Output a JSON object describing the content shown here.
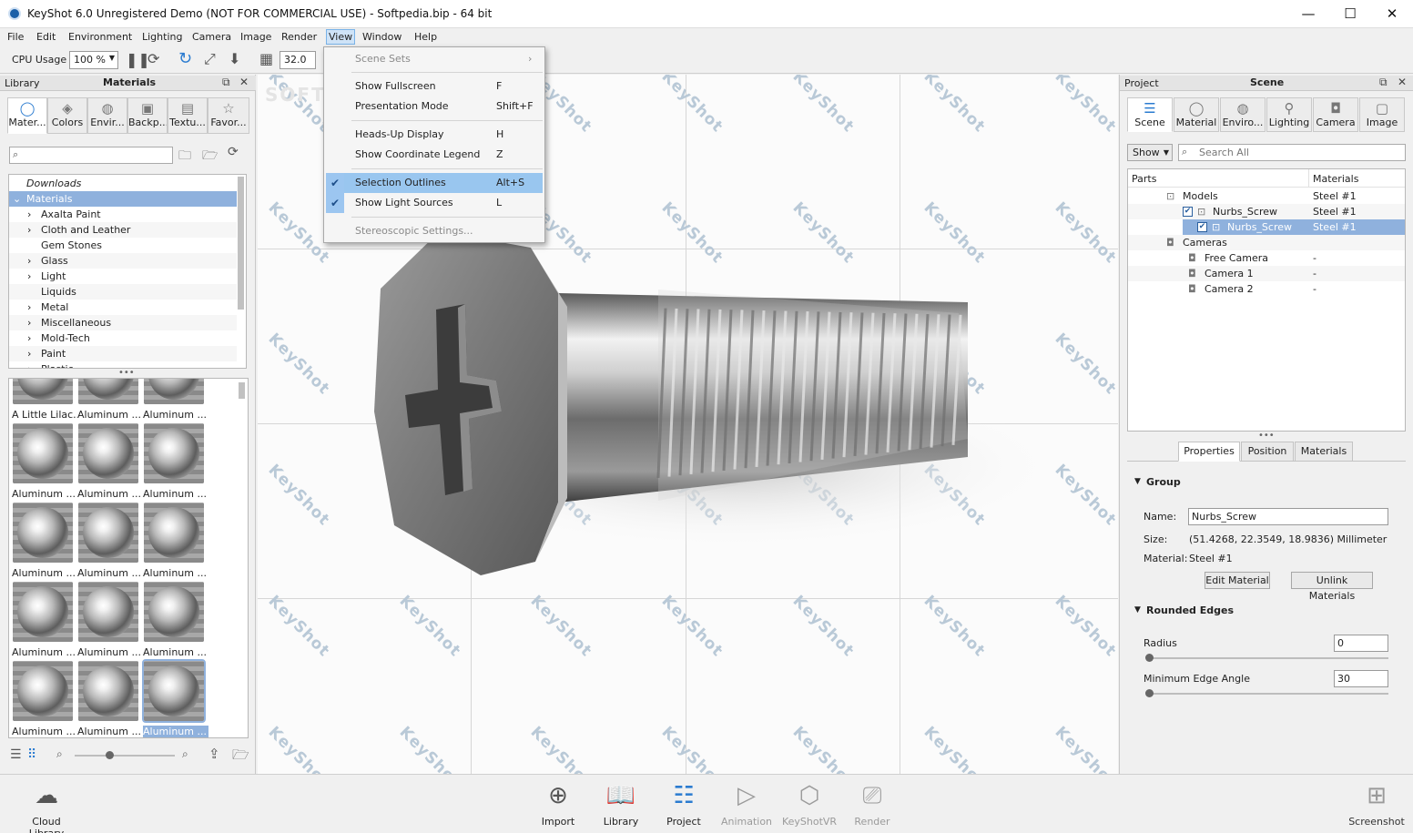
{
  "window": {
    "title": "KeyShot 6.0 Unregistered Demo (NOT FOR COMMERCIAL USE) - Softpedia.bip  - 64 bit",
    "minimize": "—",
    "maximize": "☐",
    "close": "✕"
  },
  "menubar": [
    "File",
    "Edit",
    "Environment",
    "Lighting",
    "Camera",
    "Image",
    "Render",
    "View",
    "Window",
    "Help"
  ],
  "toolbar": {
    "cpu_label": "CPU Usage",
    "cpu_value": "100 %",
    "fov_value": "32.0"
  },
  "view_menu": {
    "items": [
      {
        "label": "Scene Sets",
        "shortcut": "",
        "state": "disabled",
        "submenu": "›"
      },
      {
        "label": "Show Fullscreen",
        "shortcut": "F",
        "state": "normal"
      },
      {
        "label": "Presentation Mode",
        "shortcut": "Shift+F",
        "state": "normal"
      },
      {
        "label": "Heads-Up Display",
        "shortcut": "H",
        "state": "normal"
      },
      {
        "label": "Show Coordinate Legend",
        "shortcut": "Z",
        "state": "normal"
      },
      {
        "label": "Selection Outlines",
        "shortcut": "Alt+S",
        "state": "checked-highlighted"
      },
      {
        "label": "Show Light Sources",
        "shortcut": "L",
        "state": "checked"
      },
      {
        "label": "Stereoscopic Settings...",
        "shortcut": "",
        "state": "disabled"
      }
    ],
    "check_glyph": "✔"
  },
  "library": {
    "header_left": "Library",
    "header_title": "Materials",
    "tabs": [
      {
        "label": "Mater...",
        "icon": "material-icon"
      },
      {
        "label": "Colors",
        "icon": "colors-icon"
      },
      {
        "label": "Envir...",
        "icon": "environment-icon"
      },
      {
        "label": "Backp...",
        "icon": "backplate-icon"
      },
      {
        "label": "Textu...",
        "icon": "texture-icon"
      },
      {
        "label": "Favor...",
        "icon": "favorites-icon"
      }
    ],
    "tree": [
      {
        "label": "Downloads",
        "expander": "",
        "italic": true
      },
      {
        "label": "Materials",
        "expander": "⌄",
        "selected": true
      },
      {
        "label": "Axalta Paint",
        "expander": "›"
      },
      {
        "label": "Cloth and Leather",
        "expander": "›"
      },
      {
        "label": "Gem Stones",
        "expander": ""
      },
      {
        "label": "Glass",
        "expander": "›"
      },
      {
        "label": "Light",
        "expander": "›"
      },
      {
        "label": "Liquids",
        "expander": ""
      },
      {
        "label": "Metal",
        "expander": "›"
      },
      {
        "label": "Miscellaneous",
        "expander": "›"
      },
      {
        "label": "Mold-Tech",
        "expander": "›"
      },
      {
        "label": "Paint",
        "expander": "›"
      },
      {
        "label": "Plastic",
        "expander": "›"
      }
    ],
    "thumbs": [
      "A Little Lilac...",
      "Aluminum ...",
      "Aluminum ...",
      "Aluminum ...",
      "Aluminum ...",
      "Aluminum ...",
      "Aluminum ...",
      "Aluminum ...",
      "Aluminum ...",
      "Aluminum ...",
      "Aluminum ...",
      "Aluminum ...",
      "Aluminum ...",
      "Aluminum ...",
      "Aluminum ..."
    ]
  },
  "viewport": {
    "watermark": "KeyShot",
    "softpedia_mark": "SOFTPEDIA"
  },
  "project": {
    "header_left": "Project",
    "header_title": "Scene",
    "tabs": [
      "Scene",
      "Material",
      "Enviro...",
      "Lighting",
      "Camera",
      "Image"
    ],
    "show_label": "Show",
    "search_placeholder": "Search All",
    "col_parts": "Parts",
    "col_materials": "Materials",
    "tree": [
      {
        "label": "Models",
        "material": "Steel #1"
      },
      {
        "label": "Nurbs_Screw",
        "material": "Steel #1"
      },
      {
        "label": "Nurbs_Screw",
        "material": "Steel #1",
        "selected": true
      },
      {
        "label": "Cameras",
        "material": ""
      },
      {
        "label": "Free Camera",
        "material": "-"
      },
      {
        "label": "Camera 1",
        "material": "-"
      },
      {
        "label": "Camera 2",
        "material": "-"
      }
    ],
    "prop_tabs": [
      "Properties",
      "Position",
      "Materials"
    ],
    "group_title": "Group",
    "name_label": "Name:",
    "name_value": "Nurbs_Screw",
    "size_label": "Size:",
    "size_value": "(51.4268, 22.3549, 18.9836) Millimeter",
    "material_label": "Material:",
    "material_value": "Steel #1",
    "edit_material": "Edit Material",
    "unlink_materials": "Unlink Materials",
    "rounded_title": "Rounded Edges",
    "radius_label": "Radius",
    "radius_value": "0",
    "min_angle_label": "Minimum Edge Angle",
    "min_angle_value": "30"
  },
  "bottombar": {
    "cloud_library": "Cloud Library",
    "import": "Import",
    "library": "Library",
    "project": "Project",
    "animation": "Animation",
    "keyshotvr": "KeyShotVR",
    "render": "Render",
    "screenshot": "Screenshot"
  }
}
